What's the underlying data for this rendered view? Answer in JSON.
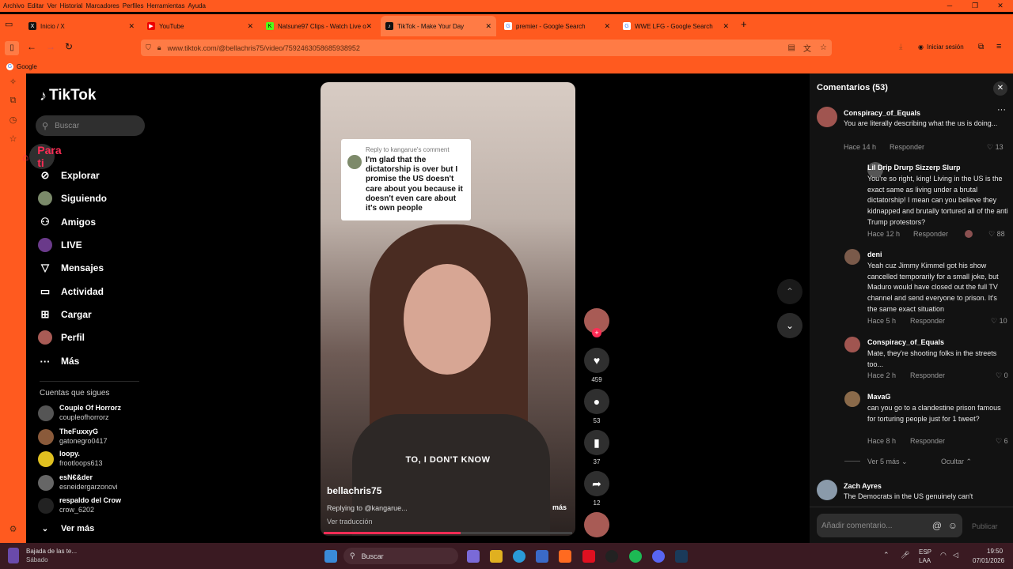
{
  "browser": {
    "menu": [
      "Archivo",
      "Editar",
      "Ver",
      "Historial",
      "Marcadores",
      "Perfiles",
      "Herramientas",
      "Ayuda"
    ],
    "tabs": [
      {
        "label": "Inicio / X",
        "icon": "x-logo-icon"
      },
      {
        "label": "YouTube",
        "icon": "youtube-icon"
      },
      {
        "label": "Natsune97 Clips - Watch Live o",
        "icon": "kick-icon"
      },
      {
        "label": "TikTok - Make Your Day",
        "icon": "tiktok-icon"
      },
      {
        "label": "premier - Google Search",
        "icon": "google-icon"
      },
      {
        "label": "WWE LFG - Google Search",
        "icon": "google-icon"
      }
    ],
    "url": "www.tiktok.com/@bellachris75/video/7592463058685938952",
    "signin": "Iniciar sesión",
    "bookmark": "Google"
  },
  "tiktok": {
    "logo": "TikTok",
    "search_placeholder": "Buscar",
    "nav": [
      "Para ti",
      "Explorar",
      "Siguiendo",
      "Amigos",
      "LIVE",
      "Mensajes",
      "Actividad",
      "Cargar",
      "Perfil",
      "Más"
    ],
    "following_title": "Cuentas que sigues",
    "following": [
      {
        "name": "Couple Of Horrorz",
        "user": "coupleofhorrorz"
      },
      {
        "name": "TheFuxxyG",
        "user": "gatonegro0417"
      },
      {
        "name": "loopy.",
        "user": "frootloops613"
      },
      {
        "name": "esN€&der",
        "user": "esneidergarzonovi"
      },
      {
        "name": "respaldo del Crow",
        "user": "crow_6202"
      }
    ],
    "see_more": "Ver más"
  },
  "video": {
    "reply_header": "Reply to kangarue's comment",
    "reply_text": "I'm glad that the dictatorship is over but I promise the US doesn't care about you because it doesn't even care about it's own people",
    "caption": "TO, I DON'T KNOW",
    "username": "bellachris75",
    "replying": "Replying to @kangarue...",
    "more": "más",
    "translation": "Ver traducción",
    "progress": 0.55
  },
  "actions": {
    "likes": "459",
    "comments": "53",
    "saves": "37",
    "shares": "12"
  },
  "comments": {
    "title": "Comentarios (53)",
    "reply_label": "Responder",
    "items": [
      {
        "name": "Conspiracy_of_Equals",
        "text": "You are literally describing what the us is doing...",
        "time": "Hace 14 h",
        "likes": "13"
      },
      {
        "name": "Lil Drip Drurp Sizzerp Slurp",
        "text": "You're so right, king! Living in the US is the exact same as living under a brutal dictatorship! I mean can you believe they kidnapped and brutally tortured all of the anti Trump protestors?",
        "time": "Hace 12 h",
        "likes": "88"
      },
      {
        "name": "deni",
        "text": "Yeah cuz Jimmy Kimmel got his show cancelled temporarily for a small joke, but Maduro would have closed out the full TV channel and send everyone to prison. It's the same exact situation",
        "time": "Hace 5 h",
        "likes": "10"
      },
      {
        "name": "Conspiracy_of_Equals",
        "text": "Mate, they're shooting folks in the streets too...",
        "time": "Hace 2 h",
        "likes": "0"
      },
      {
        "name": "MavaG",
        "text": "can you go to a clandestine prison famous for torturing people just for 1 tweet?",
        "time": "Hace 8 h",
        "likes": "6"
      },
      {
        "name": "Zach Ayres",
        "text": "The Democrats in the US genuinely can't",
        "time": "",
        "likes": ""
      }
    ],
    "see_more": "Ver 5 más",
    "hide": "Ocultar",
    "add_placeholder": "Añadir comentario...",
    "publish": "Publicar"
  },
  "taskbar": {
    "notif_title": "Bajada de las te...",
    "notif_sub": "Sábado",
    "search": "Buscar",
    "lang": "ESP",
    "lang2": "LAA",
    "time": "19:50",
    "date": "07/01/2026"
  }
}
